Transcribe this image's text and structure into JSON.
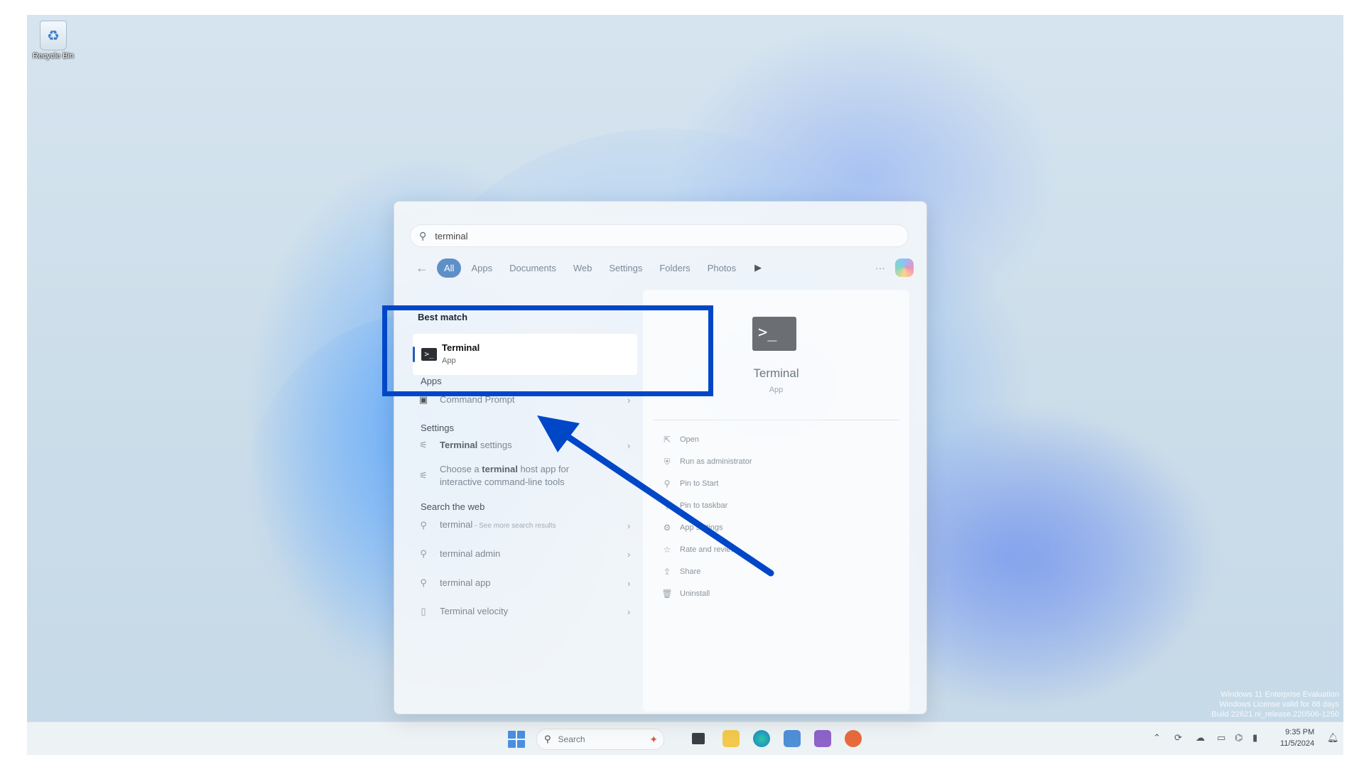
{
  "desktop": {
    "recycle_bin_label": "Recycle Bin",
    "watermark": {
      "line1": "Windows 11 Enterprise Evaluation",
      "line2": "Windows License valid for 88 days",
      "line3": "Build 22621.ni_release.220506-1250"
    }
  },
  "search_panel": {
    "query": "terminal",
    "filters": [
      "All",
      "Apps",
      "Documents",
      "Web",
      "Settings",
      "Folders",
      "Photos"
    ],
    "active_filter": "All",
    "more_label": "···",
    "best_match": {
      "section": "Best match",
      "title": "Terminal",
      "subtitle": "App"
    },
    "apps": {
      "section": "Apps",
      "items": [
        {
          "label": "Command Prompt"
        }
      ]
    },
    "settings": {
      "section": "Settings",
      "items": [
        {
          "bold": "Terminal",
          "rest": " settings"
        },
        {
          "pre": "Choose a ",
          "bold": "terminal",
          "rest": " host app for",
          "line2": "interactive command-line tools"
        }
      ]
    },
    "web": {
      "section": "Search the web",
      "items": [
        {
          "label": "terminal",
          "sub": " - See more search results"
        },
        {
          "label": "terminal admin"
        },
        {
          "label": "terminal app"
        },
        {
          "label": "Terminal velocity"
        }
      ]
    },
    "preview": {
      "title": "Terminal",
      "subtitle": "App",
      "actions": [
        "Open",
        "Run as administrator",
        "Pin to Start",
        "Pin to taskbar",
        "App settings",
        "Rate and review",
        "Share",
        "Uninstall"
      ]
    }
  },
  "taskbar": {
    "search_label": "Search",
    "time": "9:35 PM",
    "date": "11/5/2024"
  },
  "annotation": {
    "box_color": "#0047c8",
    "arrow_color": "#0047c8"
  }
}
